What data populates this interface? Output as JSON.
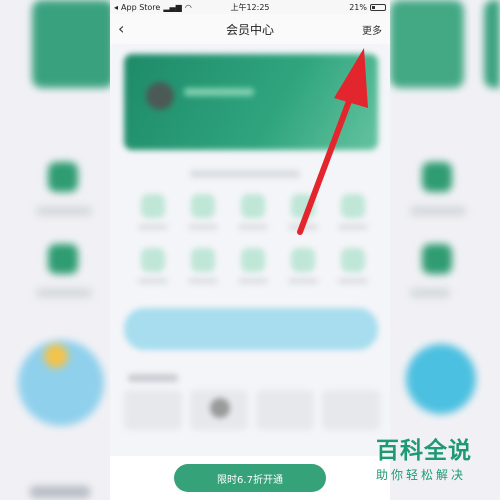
{
  "status_bar": {
    "carrier": "App Store",
    "time": "上午12:25",
    "battery": "21%"
  },
  "nav": {
    "back_icon": "chevron-left-icon",
    "title": "会员中心",
    "more": "更多"
  },
  "footer": {
    "button_label": "限时6.7折开通"
  },
  "watermark": {
    "main": "百科全说",
    "sub": "助你轻松解决"
  },
  "colors": {
    "accent": "#35a27a",
    "arrow": "#e3262d",
    "watermark": "#1e9a72"
  }
}
